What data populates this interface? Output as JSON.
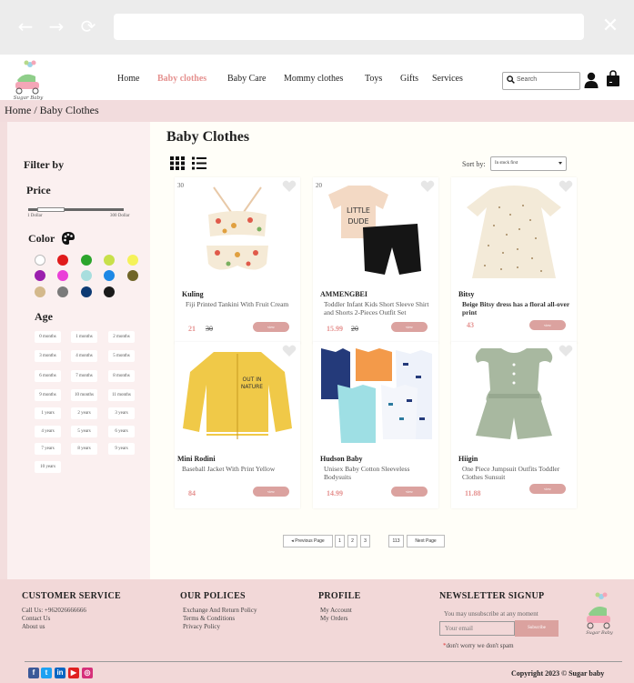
{
  "browser": {
    "url": ""
  },
  "nav": {
    "items": [
      {
        "label": "Home",
        "active": false
      },
      {
        "label": "Baby clothes",
        "active": true
      },
      {
        "label": "Baby Care",
        "active": false
      },
      {
        "label": "Mommy clothes",
        "active": false
      },
      {
        "label": "Toys",
        "active": false
      },
      {
        "label": "Gifts",
        "active": false
      },
      {
        "label": "Services",
        "active": false
      }
    ],
    "search_placeholder": "Search",
    "logo_text": "Sugar Baby"
  },
  "breadcrumb": "Home / Baby Clothes",
  "sidebar": {
    "filter_title": "Filter by",
    "price_title": "Price",
    "price_min": "1 Dollar",
    "price_max": "300 Dollar",
    "color_title": "Color",
    "colors": [
      "#ffffff",
      "#e01b1b",
      "#2ca52c",
      "#c8e04a",
      "#f5f25a",
      "#9b1fae",
      "#ea3fd8",
      "#a8dede",
      "#1e88e5",
      "#706528",
      "#d4b98c",
      "#7a7a7a",
      "#0d3a73",
      "#1a1a1a"
    ],
    "age_title": "Age",
    "ages": [
      "0 months",
      "1 months",
      "2 months",
      "3 months",
      "4 months",
      "5 months",
      "6 months",
      "7 months",
      "8 months",
      "9 months",
      "10 months",
      "11 months",
      "1 years",
      "2 years",
      "3 years",
      "4 years",
      "5 years",
      "6 years",
      "7 years",
      "8 years",
      "9 years",
      "10 years"
    ]
  },
  "main": {
    "title": "Baby Clothes",
    "sort_label": "Sort by:",
    "sort_value": "In stock first"
  },
  "products": [
    {
      "discount": "30",
      "brand": "Kuling",
      "name": "Fiji Printed Tankini With Fruit Cream",
      "price": "21",
      "old_price": "30",
      "view": "view"
    },
    {
      "discount": "20",
      "brand": "AMMENGBEI",
      "name": "Toddler Infant Kids Short Sleeve Shirt and Shorts 2-Pieces Outfit Set",
      "price": "15.99",
      "old_price": "20",
      "view": "view"
    },
    {
      "discount": "",
      "brand": "Bitsy",
      "name": "Beige Bitsy dress has a floral all-over print",
      "price": "43",
      "old_price": "",
      "view": "view"
    },
    {
      "discount": "",
      "brand": "Mini Rodini",
      "name": "Baseball Jacket With Print Yellow",
      "price": "84",
      "old_price": "",
      "view": "view"
    },
    {
      "discount": "",
      "brand": "Hudson Baby",
      "name": "Unisex Baby Cotton Sleeveless Bodysuits",
      "price": "14.99",
      "old_price": "",
      "view": "view"
    },
    {
      "discount": "",
      "brand": "Hiigin",
      "name": "One Piece Jumpsuit Outfits Toddler Clothes Sunsuit",
      "price": "11.88",
      "old_price": "",
      "view": "view"
    }
  ],
  "pagination": {
    "prev": "Previous Page",
    "pages": [
      "1",
      "2",
      "3"
    ],
    "last": "113",
    "next": "Next Page"
  },
  "footer": {
    "customer_service": {
      "title": "CUSTOMER SERVICE",
      "links": [
        "Call Us: +962026666666",
        "Contact Us",
        "About us"
      ]
    },
    "policies": {
      "title": "OUR POLICES",
      "links": [
        "Exchange And Return Policy",
        "Terms & Conditions",
        "Privacy Policy"
      ]
    },
    "profile": {
      "title": "PROFILE",
      "links": [
        "My Account",
        "My Orders"
      ]
    },
    "newsletter": {
      "title": "NEWSLETTER SIGNUP",
      "note": "You may unsubscribe at any moment",
      "email_placeholder": "Your email",
      "subscribe": "Subscribe",
      "spam_note": "don't worry we don't spam"
    },
    "social": [
      "facebook",
      "twitter",
      "linkedin",
      "youtube",
      "instagram"
    ],
    "copyright": "Copyright 2023  © Sugar baby"
  }
}
